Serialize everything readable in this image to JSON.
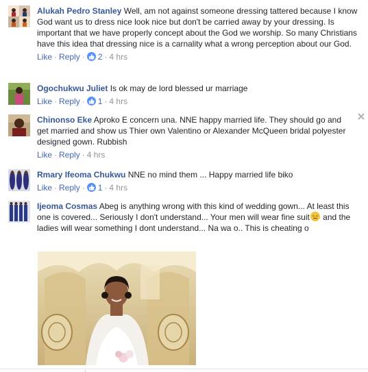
{
  "comments": [
    {
      "author": "Alukah Pedro Stanley",
      "text": "Well, am not against someone dressing tattered because I know God want us to dress nice look nice but don't be carried away by your dressing. Is important that we have properly concept about the God we worship. So many Christians have this idea that dressing nice is a carnality what a wrong perception about our God.",
      "like_label": "Like",
      "reply_label": "Reply",
      "like_count": "2",
      "time": "4 hrs"
    },
    {
      "author": "Ogochukwu Juliet",
      "text": "Is ok may de lord blessed ur marriage",
      "like_label": "Like",
      "reply_label": "Reply",
      "like_count": "1",
      "time": "4 hrs"
    },
    {
      "author": "Chinonso Eke",
      "text": "Aproko E concern una. NNE happy married life. They should go and get married and show us Thier own Valentino or Alexander McQueen bridal polyester designed gown. Rubbish",
      "like_label": "Like",
      "reply_label": "Reply",
      "time": "4 hrs"
    },
    {
      "author": "Rmary Ifeoma Chukwu",
      "text": "NNE no mind them ... Happy married life biko",
      "like_label": "Like",
      "reply_label": "Reply",
      "like_count": "1",
      "time": "4 hrs"
    },
    {
      "author": "Ijeoma Cosmas",
      "text_part1": "Abeg is anything wrong with this kind of wedding gown... At least this one is covered... Seriously I don't understand... Your men will wear fine suit",
      "text_part2": " and the ladies will wear something I dont understand... Na wa o.. This is cheating o"
    }
  ],
  "icons": {
    "like": "thumbs-up-icon",
    "close": "close-icon",
    "emoji": "disappointed-face-icon"
  },
  "colors": {
    "author": "#365899",
    "link": "#4267b2",
    "meta": "#90949c",
    "like_badge": "#5890ff"
  }
}
